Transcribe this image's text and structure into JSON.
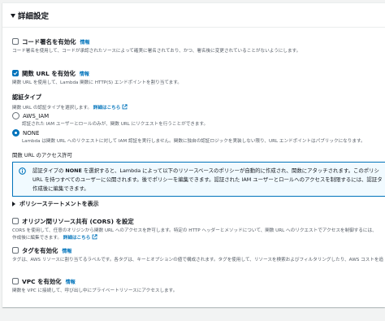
{
  "section": {
    "title": "詳細設定"
  },
  "code_signing": {
    "label": "コード署名を有効化",
    "info": "情報",
    "checked": false,
    "description": "コード署名を使用して、コードが承認されたソースによって確実に署名されており、かつ、署名後に変更されていることがないようにします。"
  },
  "function_url": {
    "label": "関数 URL を有効化",
    "info": "情報",
    "checked": true,
    "description": "関数 URL を使用して、Lambda 関数に HTTP(S) エンドポイントを割り当てます。"
  },
  "auth_type": {
    "label": "認証タイプ",
    "description": "関数 URL の認証タイプを選択します。",
    "learn_more": "詳細はこちら",
    "options": [
      {
        "label": "AWS_IAM",
        "description": "認証された IAM ユーザーとロールのみが、関数 URL にリクエストを行うことができます。",
        "selected": false
      },
      {
        "label": "NONE",
        "description": "Lambda は関数 URL へのリクエストに対して IAM 認証を実行しません。関数に独自の認証ロジックを実装しない限り、URL エンドポイントはパブリックになります。",
        "selected": true
      }
    ]
  },
  "permissions": {
    "label": "関数 URL のアクセス許可",
    "alert_line1_prefix": "認証タイプの ",
    "alert_line1_bold": "NONE",
    "alert_line1_suffix": " を選択すると、Lambda によって以下のリソースベースのポリシーが自動的に作成され、関数にアタッチされます。このポリシ",
    "alert_line2": "URL を持つすべてのユーザーに公開されます。後でポリシーを編集できます。認証された IAM ユーザーとロールへのアクセスを制限するには、認証タ",
    "alert_line3": "作成後に編集できます。"
  },
  "policy_statement": {
    "label": "ポリシーステートメントを表示"
  },
  "cors": {
    "label": "オリジン間リソース共有 (CORS) を設定",
    "checked": false,
    "description": "CORS を使用して、任意のオリジンから関数 URL へのアクセスを許可します。特定の HTTP ヘッダーとメソッドについて、関数 URL へのリクエストでアクセスを制御するには、",
    "description2": "作成後に編集できます。",
    "learn_more": "詳細はこちら"
  },
  "tags": {
    "label": "タグを有効化",
    "info": "情報",
    "checked": false,
    "description": "タグは、AWS リソースに割り当てるラベルです。各タグは、キーとオプションの値で構成されます。タグを使用して、リソースを検索およびフィルタリングしたり、AWS コストを追"
  },
  "vpc": {
    "label": "VPC を有効化",
    "info": "情報",
    "checked": false,
    "description": "関数を VPC に接続して、呼び出し中にプライベートリソースにアクセスします。"
  },
  "colors": {
    "accent": "#0073bb",
    "alert_bg": "#f1faff",
    "text": "#16191f",
    "muted": "#545b64"
  }
}
